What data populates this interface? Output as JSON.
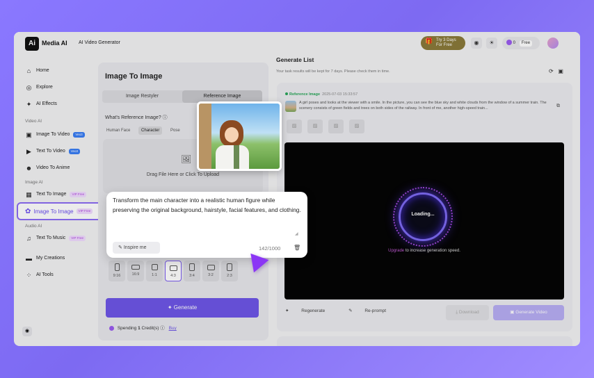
{
  "topbar": {
    "logo_mark": "Ai",
    "app_name": "Media AI",
    "product": "AI Video Generator",
    "trial_line1": "Try 3 Days",
    "trial_line2": "For Free",
    "credits": "0",
    "plan": "Free"
  },
  "sidebar": {
    "home": "Home",
    "explore": "Explore",
    "ai_effects": "AI Effects",
    "section_video": "Video AI",
    "image_to_video": "Image To Video",
    "text_to_video": "Text To Video",
    "video_to_anime": "Video To Anime",
    "veo_badge": "Veo3",
    "section_image": "Image AI",
    "text_to_image": "Text To Image",
    "image_to_image": "Image To Image",
    "vip_badge": "VIP Free",
    "section_audio": "Audio AI",
    "text_to_music": "Text To Music",
    "my_creations": "My Creations",
    "ai_tools": "AI Tools"
  },
  "panel": {
    "title": "Image To Image",
    "tab_restyler": "Image Restyler",
    "tab_reference": "Reference Image",
    "question": "What's Reference Image?",
    "sub_human": "Human Face",
    "sub_character": "Character",
    "sub_pose": "Pose",
    "upload_text": "Drag File Here or Click To Upload",
    "ratios": [
      "9:16",
      "16:9",
      "1:1",
      "4:3",
      "3:4",
      "3:2",
      "2:3"
    ],
    "selected_ratio": "4:3",
    "generate": "Generate",
    "spending_pre": "Spending",
    "spending_num": "1",
    "spending_post": "Credit(s)",
    "buy": "Buy"
  },
  "prompt": {
    "text": "Transform the main character into a realistic human figure while preserving the original background, hairstyle, facial features, and clothing.",
    "inspire": "Inspire me",
    "counter": "142/1000"
  },
  "generate_list": {
    "title": "Generate List",
    "subtitle": "Your task results will be kept for 7 days. Please check them in time.",
    "card": {
      "tag": "Reference Image",
      "timestamp": "2025-07-03 15:33:57",
      "description": "A girl poses and looks at the viewer with a smile. In the picture, you can see the blue sky and white clouds from the window of a summer train. The scenery consists of green fields and trees on both sides of the railway. In front of me, another high-speed train...",
      "loading": "Loading...",
      "upgrade_link": "Upgrade",
      "upgrade_rest": "to increase generation speed.",
      "regenerate": "Regenerate",
      "reprompt": "Re-prompt",
      "download": "Download",
      "generate_video": "Generate Video"
    }
  },
  "colors": {
    "accent": "#6e56e8",
    "success": "#2aa65a",
    "background": "#8a78ff"
  }
}
